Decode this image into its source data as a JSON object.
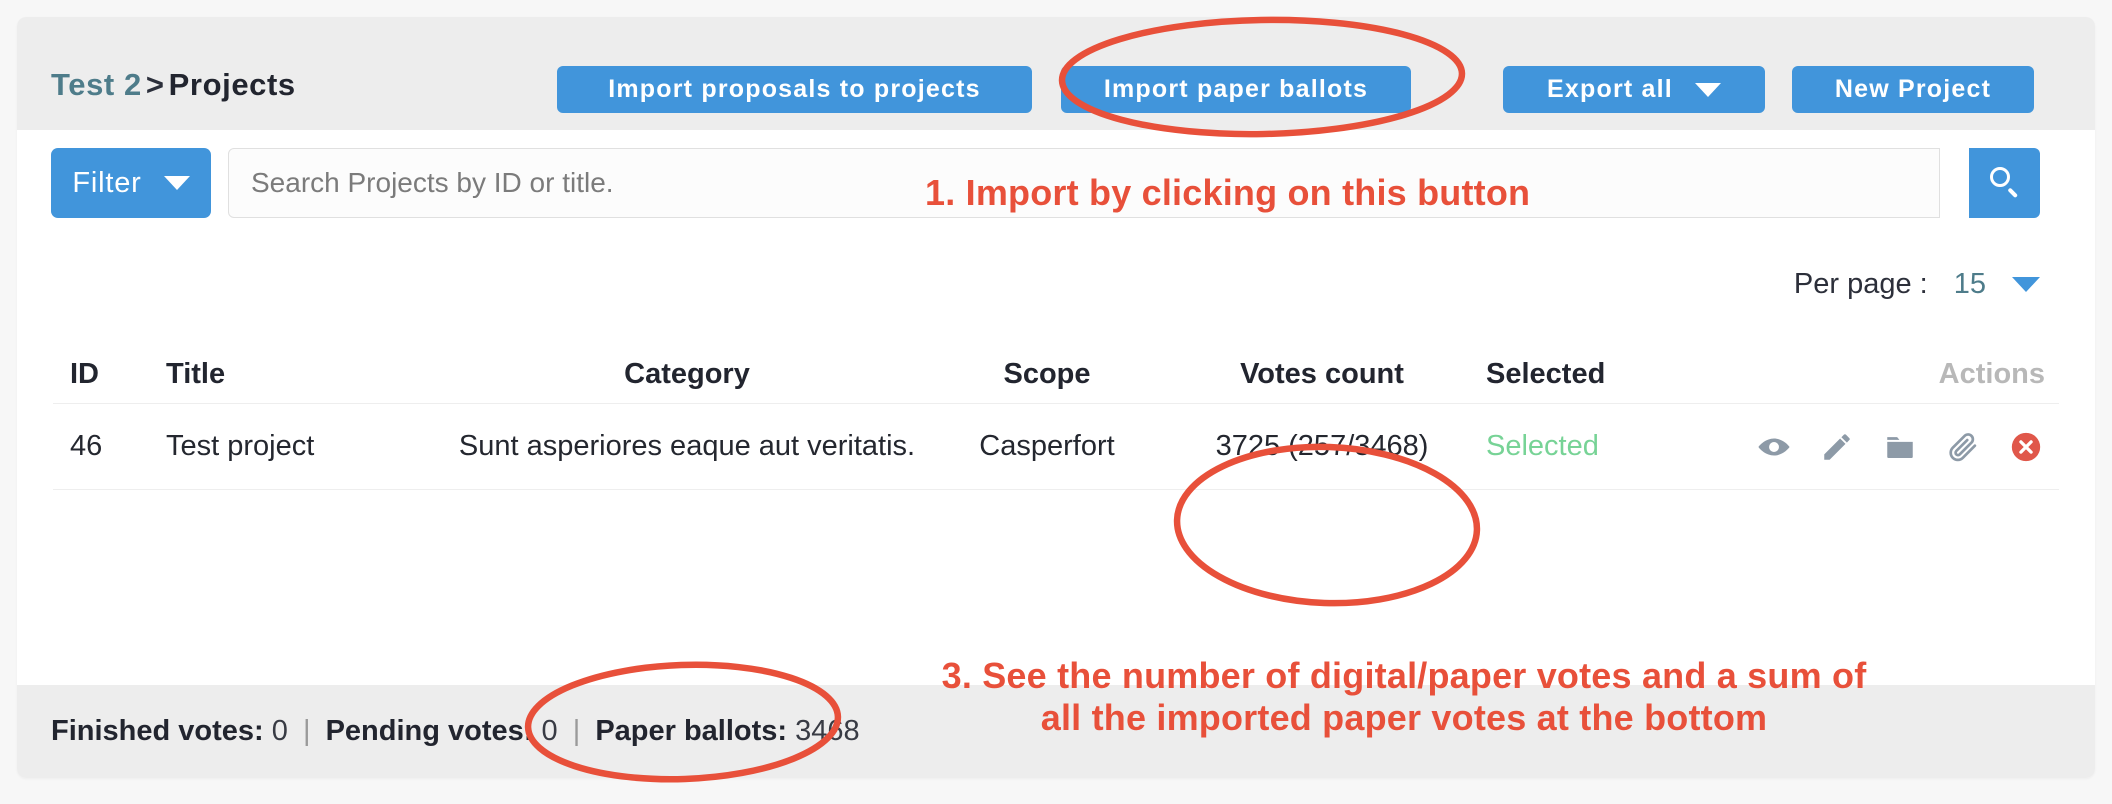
{
  "header": {
    "breadcrumb": {
      "parent": "Test 2",
      "separator": ">",
      "current": "Projects"
    },
    "buttons": {
      "import_proposals": "Import proposals to projects",
      "import_paper_ballots": "Import paper ballots",
      "export_all": "Export all",
      "new_project": "New Project"
    }
  },
  "toolbar": {
    "filter_label": "Filter",
    "search_placeholder": "Search Projects by ID or title.",
    "search_value": "",
    "search_icon": "search-icon"
  },
  "pagination": {
    "per_page_label": "Per page :",
    "per_page_value": "15"
  },
  "table": {
    "columns": [
      "ID",
      "Title",
      "Category",
      "Scope",
      "Votes count",
      "Selected",
      "Actions"
    ],
    "rows": [
      {
        "id": "46",
        "title": "Test project",
        "category": "Sunt asperiores eaque aut veritatis.",
        "scope": "Casperfort",
        "votes_count": "3725 (257/3468)",
        "selected": "Selected",
        "actions": [
          "eye-icon",
          "pencil-icon",
          "folder-icon",
          "paperclip-icon",
          "delete-circle-icon"
        ]
      }
    ]
  },
  "footer": {
    "finished_votes_label": "Finished votes:",
    "finished_votes_value": "0",
    "pending_votes_label": "Pending votes:",
    "pending_votes_value": "0",
    "paper_ballots_label": "Paper ballots:",
    "paper_ballots_value": "3468",
    "divider": "|"
  },
  "annotations": {
    "step_1": "1. Import by clicking on this button",
    "step_3_line_1": "3. See the number of digital/paper votes and a sum of",
    "step_3_line_2": "all the imported paper votes at the bottom"
  },
  "colors": {
    "accent_blue": "#4195db",
    "annotation_red": "#e8503a",
    "selected_green": "#77d396",
    "header_gray": "#ededed",
    "breadcrumb_teal": "#4e7c8a"
  }
}
